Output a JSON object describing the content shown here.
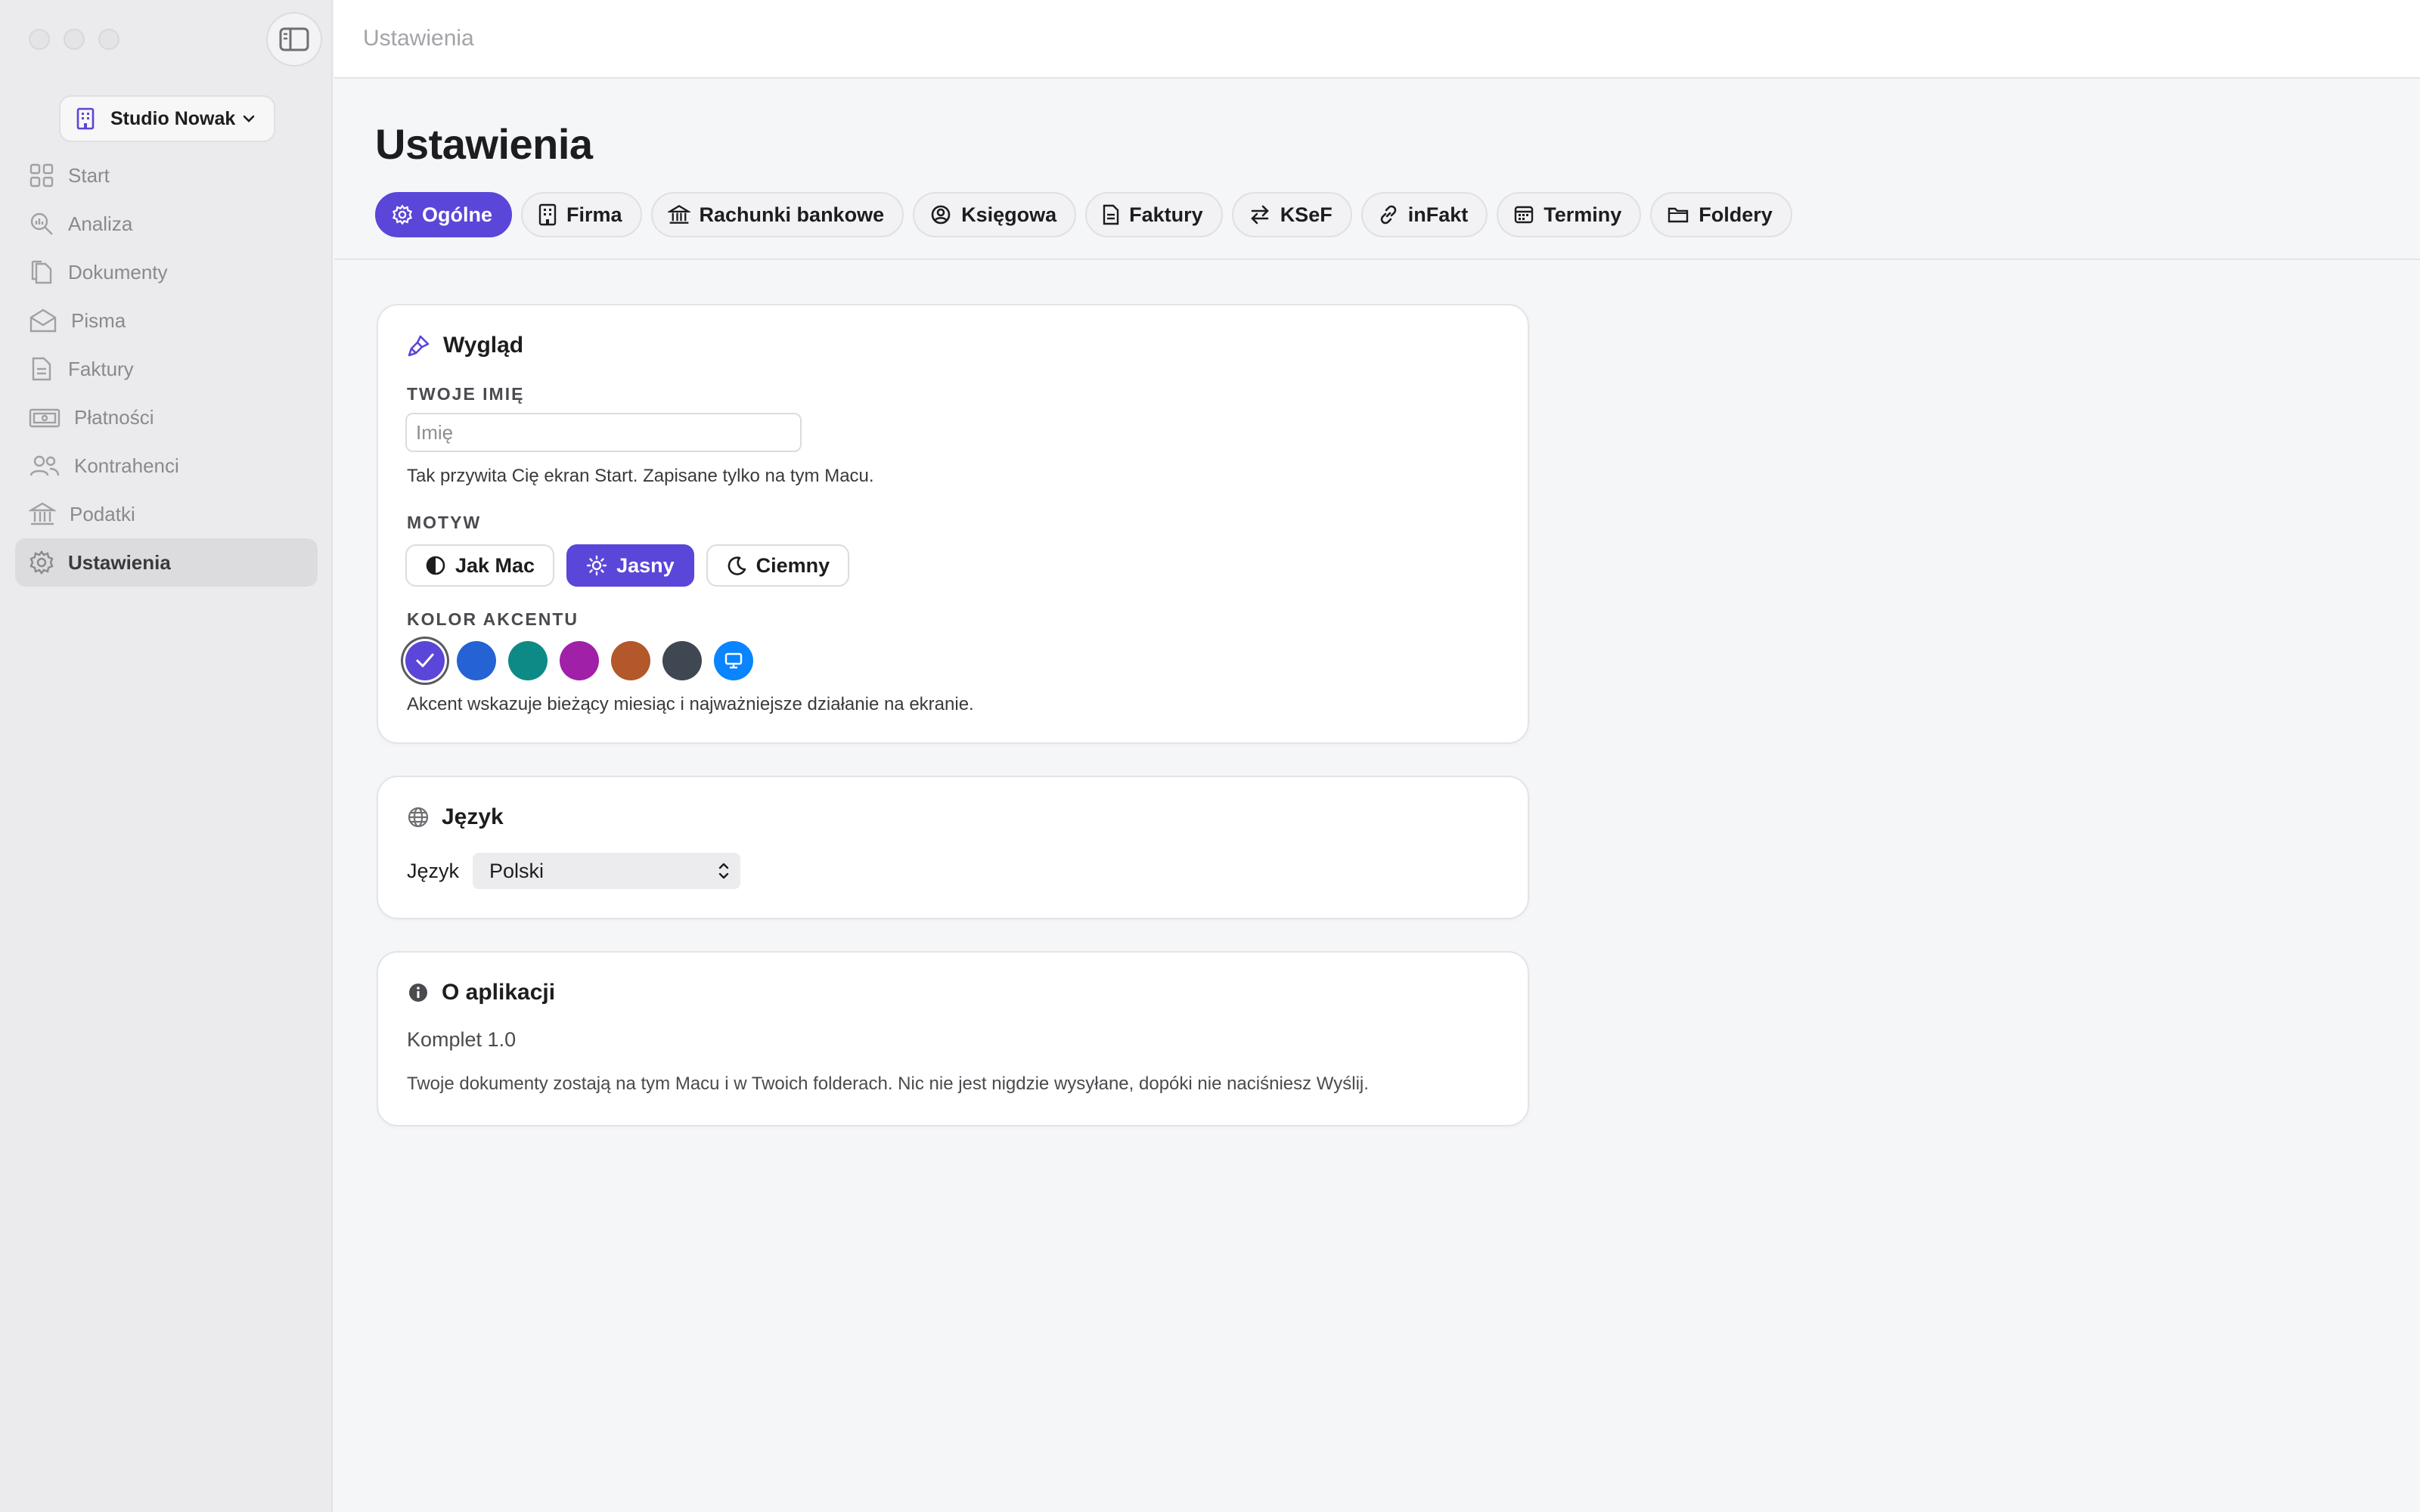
{
  "sidebar": {
    "workspace": "Studio Nowak",
    "items": [
      {
        "label": "Start",
        "icon": "grid-icon"
      },
      {
        "label": "Analiza",
        "icon": "magnifier-chart-icon"
      },
      {
        "label": "Dokumenty",
        "icon": "documents-icon"
      },
      {
        "label": "Pisma",
        "icon": "envelope-icon"
      },
      {
        "label": "Faktury",
        "icon": "invoice-icon"
      },
      {
        "label": "Płatności",
        "icon": "banknote-icon"
      },
      {
        "label": "Kontrahenci",
        "icon": "people-icon"
      },
      {
        "label": "Podatki",
        "icon": "bank-icon"
      },
      {
        "label": "Ustawienia",
        "icon": "gear-icon",
        "active": true
      }
    ]
  },
  "topbar": {
    "title": "Ustawienia"
  },
  "page": {
    "title": "Ustawienia"
  },
  "tabs": [
    {
      "label": "Ogólne",
      "icon": "gear-icon",
      "active": true
    },
    {
      "label": "Firma",
      "icon": "building-icon"
    },
    {
      "label": "Rachunki bankowe",
      "icon": "bank-icon"
    },
    {
      "label": "Księgowa",
      "icon": "person-circle-icon"
    },
    {
      "label": "Faktury",
      "icon": "document-icon"
    },
    {
      "label": "KSeF",
      "icon": "arrows-swap-icon"
    },
    {
      "label": "inFakt",
      "icon": "link-icon"
    },
    {
      "label": "Terminy",
      "icon": "calendar-icon"
    },
    {
      "label": "Foldery",
      "icon": "folder-icon"
    }
  ],
  "appearance": {
    "title": "Wygląd",
    "name_label": "TWOJE IMIĘ",
    "name_placeholder": "Imię",
    "name_value": "",
    "name_helper": "Tak przywita Cię ekran Start. Zapisane tylko na tym Macu.",
    "theme_label": "MOTYW",
    "themes": [
      {
        "label": "Jak Mac",
        "icon": "half-circle-icon"
      },
      {
        "label": "Jasny",
        "icon": "sun-icon",
        "active": true
      },
      {
        "label": "Ciemny",
        "icon": "moon-icon"
      }
    ],
    "accent_label": "KOLOR AKCENTU",
    "accents": [
      {
        "color": "#5a46d8",
        "selected": true
      },
      {
        "color": "#2563d4"
      },
      {
        "color": "#0e8a86"
      },
      {
        "color": "#a020a8"
      },
      {
        "color": "#b3582a"
      },
      {
        "color": "#3f4752"
      },
      {
        "color": "#0a84ff",
        "icon": "display-icon"
      }
    ],
    "accent_helper": "Akcent wskazuje bieżący miesiąc i najważniejsze działanie na ekranie."
  },
  "language": {
    "title": "Język",
    "field_label": "Język",
    "selected": "Polski"
  },
  "about": {
    "title": "O aplikacji",
    "version": "Komplet 1.0",
    "description": "Twoje dokumenty zostają na tym Macu i w Twoich folderach. Nic nie jest nigdzie wysyłane, dopóki nie naciśniesz Wyślij."
  }
}
